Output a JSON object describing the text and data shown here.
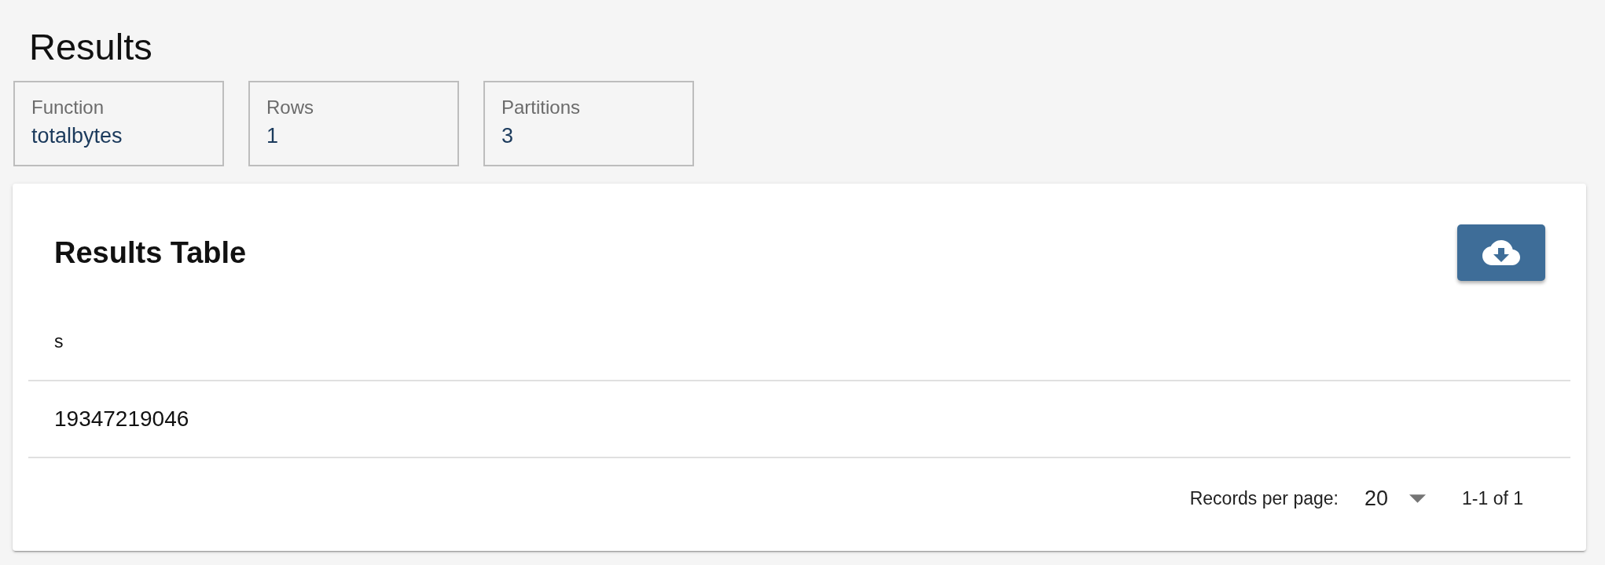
{
  "page": {
    "title": "Results"
  },
  "summary_cards": [
    {
      "label": "Function",
      "value": "totalbytes"
    },
    {
      "label": "Rows",
      "value": "1"
    },
    {
      "label": "Partitions",
      "value": "3"
    }
  ],
  "results_card": {
    "title": "Results Table",
    "table": {
      "columns": [
        "s"
      ],
      "rows": [
        [
          "19347219046"
        ]
      ]
    },
    "pagination": {
      "label": "Records per page:",
      "page_size": "20",
      "range": "1-1 of 1"
    }
  }
}
